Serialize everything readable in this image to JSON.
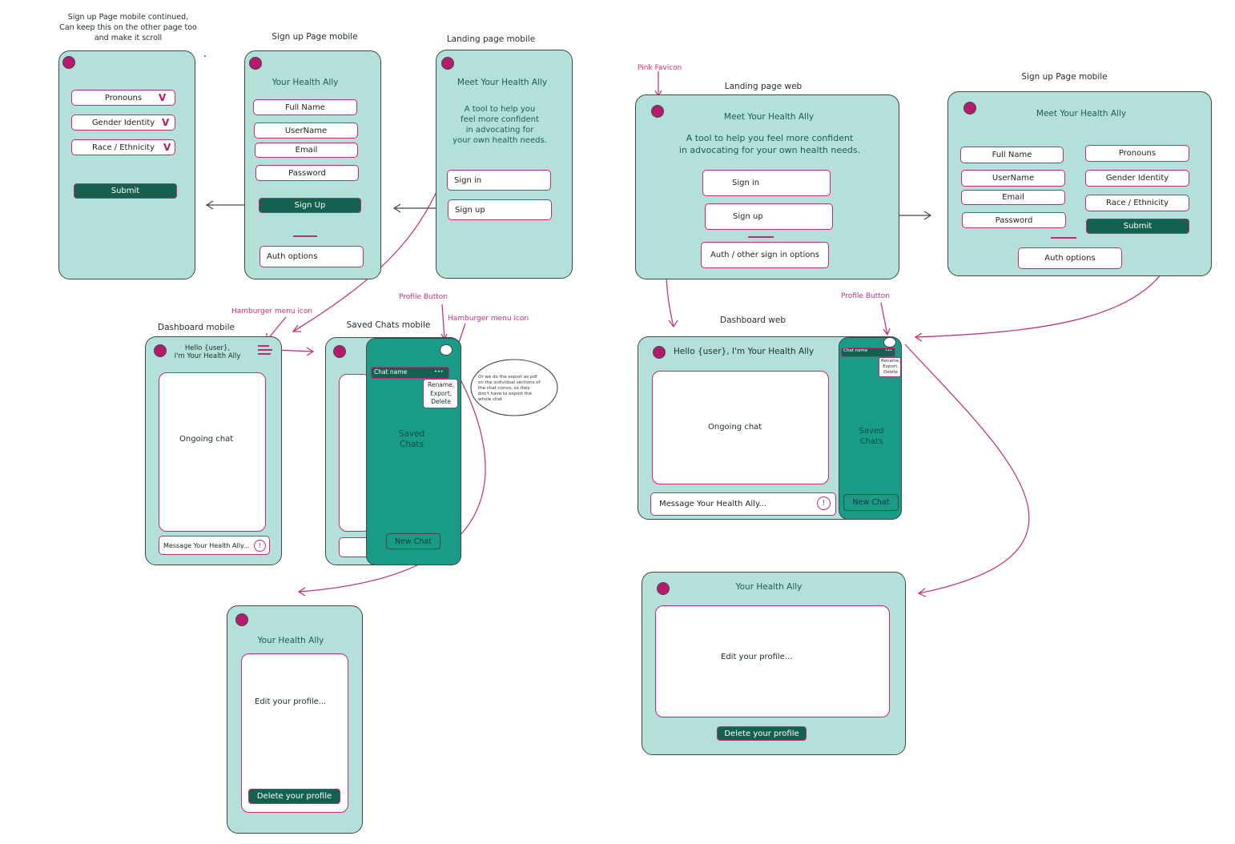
{
  "labels": {
    "signup_cont_note": "Sign up Page mobile continued,\nCan keep this on the other page too\nand make it scroll",
    "signup_mobile": "Sign up Page mobile",
    "landing_mobile": "Landing page mobile",
    "pink_favicon": "Pink Favicon",
    "landing_web": "Landing page web",
    "signup_mobile_web": "Sign up Page mobile",
    "hamburger_note": "Hamburger menu icon",
    "dashboard_mobile": "Dashboard mobile",
    "profile_button_note": "Profile Button",
    "hamburger_note_2": "Hamburger menu icon",
    "saved_chats_mobile": "Saved Chats mobile",
    "profile_button_note_2": "Profile Button",
    "dashboard_web": "Dashboard web",
    "export_note": "Or we do the export as pdf\non the individual sections of\nthe chat convo, so they\ndon't have to export the\nwhole chat"
  },
  "common": {
    "app_name": "Your Health Ally",
    "meet": "Meet Your Health Ally",
    "tagline_mobile": "A tool to help you\nfeel more confident\nin advocating for\nyour own health needs.",
    "tagline_web": "A tool to help you feel more confident\nin advocating for your own health needs.",
    "sign_in": "Sign in",
    "sign_up": "Sign up",
    "sign_up_btn": "Sign Up",
    "auth_options": "Auth options",
    "auth_other": "Auth / other sign in options",
    "full_name": "Full Name",
    "username": "UserName",
    "email": "Email",
    "password": "Password",
    "pronouns": "Pronouns",
    "gender": "Gender Identity",
    "race": "Race / Ethnicity",
    "submit": "Submit",
    "hello_mobile": "Hello {user},\nI'm Your Health Ally",
    "hello_web": "Hello {user}, I'm Your Health Ally",
    "ongoing_chat": "Ongoing chat",
    "message_mobile": "Message Your Health Ally...",
    "message_web": "Message Your Health Ally...",
    "chat_name": "Chat name",
    "dots": "•••",
    "rename_export_delete": "Rename,\nExport,\nDelete",
    "saved_chats": "Saved\nChats",
    "new_chat": "New Chat",
    "edit_profile": "Edit your profile...",
    "delete_profile": "Delete your profile",
    "send_icon": "!",
    "chevron": "V"
  },
  "colors": {
    "frame": "#b3e1da",
    "accent": "#b51a6c",
    "button": "#14614f",
    "panel": "#1a9b88"
  }
}
